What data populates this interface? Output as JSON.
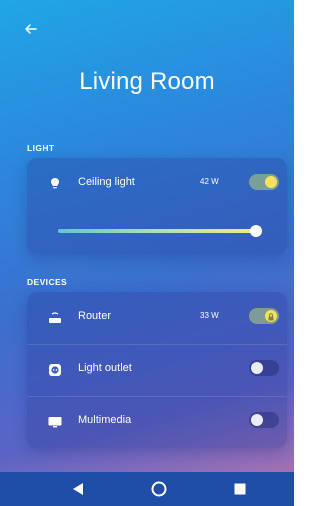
{
  "header": {
    "back_icon": "arrow-left-icon",
    "title": "Living Room"
  },
  "light_section": {
    "label": "LIGHT",
    "item": {
      "icon": "lightbulb-icon",
      "label": "Ceiling light",
      "watts": "42 W",
      "toggle_on": true,
      "brightness": 0.97
    }
  },
  "devices_section": {
    "label": "DEVICES",
    "items": [
      {
        "icon": "router-icon",
        "label": "Router",
        "watts": "33 W",
        "toggle_on": true,
        "locked": true
      },
      {
        "icon": "power-outlet-icon",
        "label": "Light outlet",
        "watts": "",
        "toggle_on": false
      },
      {
        "icon": "monitor-icon",
        "label": "Multimedia",
        "watts": "",
        "toggle_on": false
      }
    ]
  },
  "colors": {
    "toggle_knob_on": "#f6e15b",
    "nav_bar": "#1f4ea8",
    "background_top": "#20a6e6",
    "background_bottom": "#c5768d"
  },
  "navbar": {
    "back": "nav-back-icon",
    "home": "nav-home-icon",
    "recents": "nav-recents-icon"
  }
}
